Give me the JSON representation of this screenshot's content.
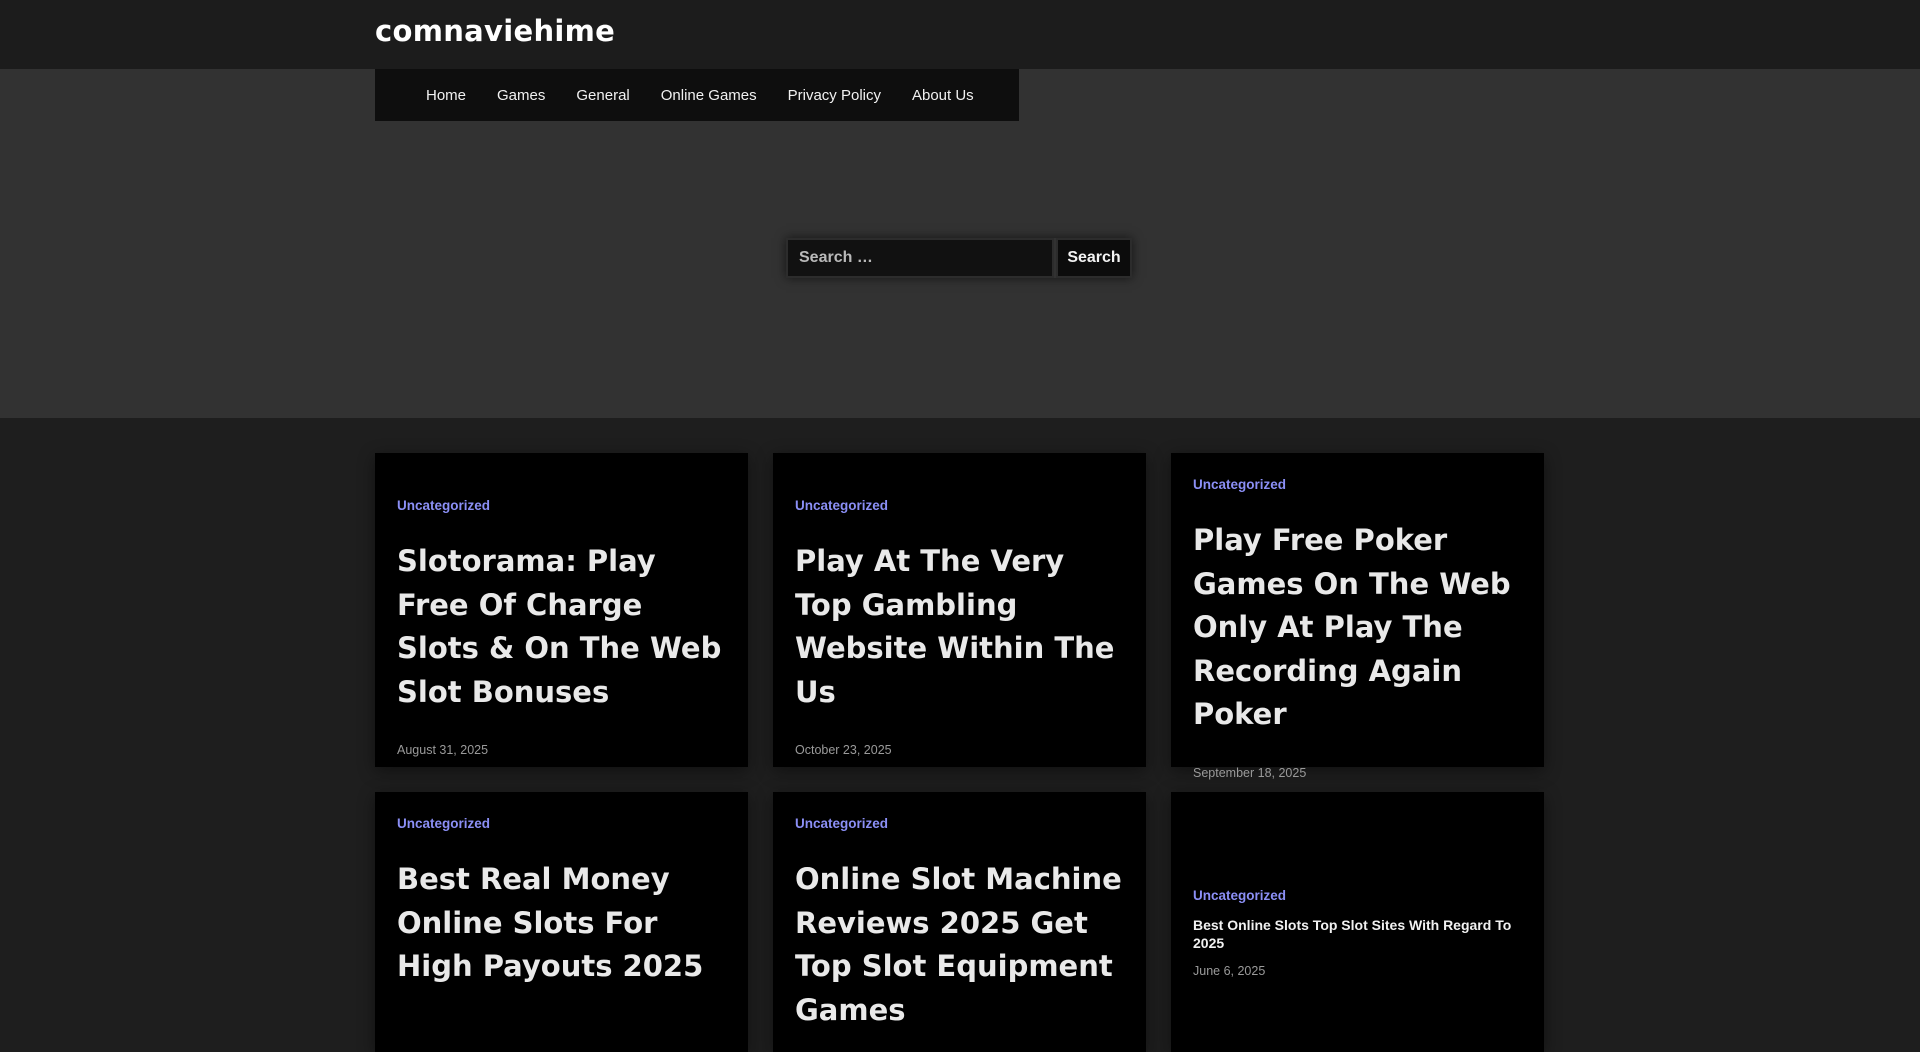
{
  "site": {
    "title": "comnaviehime"
  },
  "nav": {
    "items": [
      {
        "label": "Home"
      },
      {
        "label": "Games"
      },
      {
        "label": "General"
      },
      {
        "label": "Online Games"
      },
      {
        "label": "Privacy Policy"
      },
      {
        "label": "About Us"
      }
    ]
  },
  "search": {
    "placeholder": "Search …",
    "button_label": "Search"
  },
  "posts": [
    {
      "category": "Uncategorized",
      "title": "Slotorama: Play Free Of Charge Slots & On The Web Slot Bonuses",
      "date": "August 31, 2025"
    },
    {
      "category": "Uncategorized",
      "title": "Play At The Very Top Gambling Website Within The Us",
      "date": "October 23, 2025"
    },
    {
      "category": "Uncategorized",
      "title": "Play Free Poker Games On The Web Only At Play The Recording Again Poker",
      "date": "September 18, 2025"
    },
    {
      "category": "Uncategorized",
      "title": "Best Real Money Online Slots For High Payouts 2025",
      "date": ""
    },
    {
      "category": "Uncategorized",
      "title": "Online Slot Machine Reviews 2025 Get Top Slot Equipment Games",
      "date": ""
    },
    {
      "category": "Uncategorized",
      "title": "Best Online Slots Top Slot Sites With Regard To 2025",
      "date": "June 6, 2025"
    }
  ],
  "colors": {
    "accent": "#8b8ff5",
    "header_bg": "#1c1c1c",
    "hero_bg": "#323232",
    "card_bg": "#000000"
  }
}
